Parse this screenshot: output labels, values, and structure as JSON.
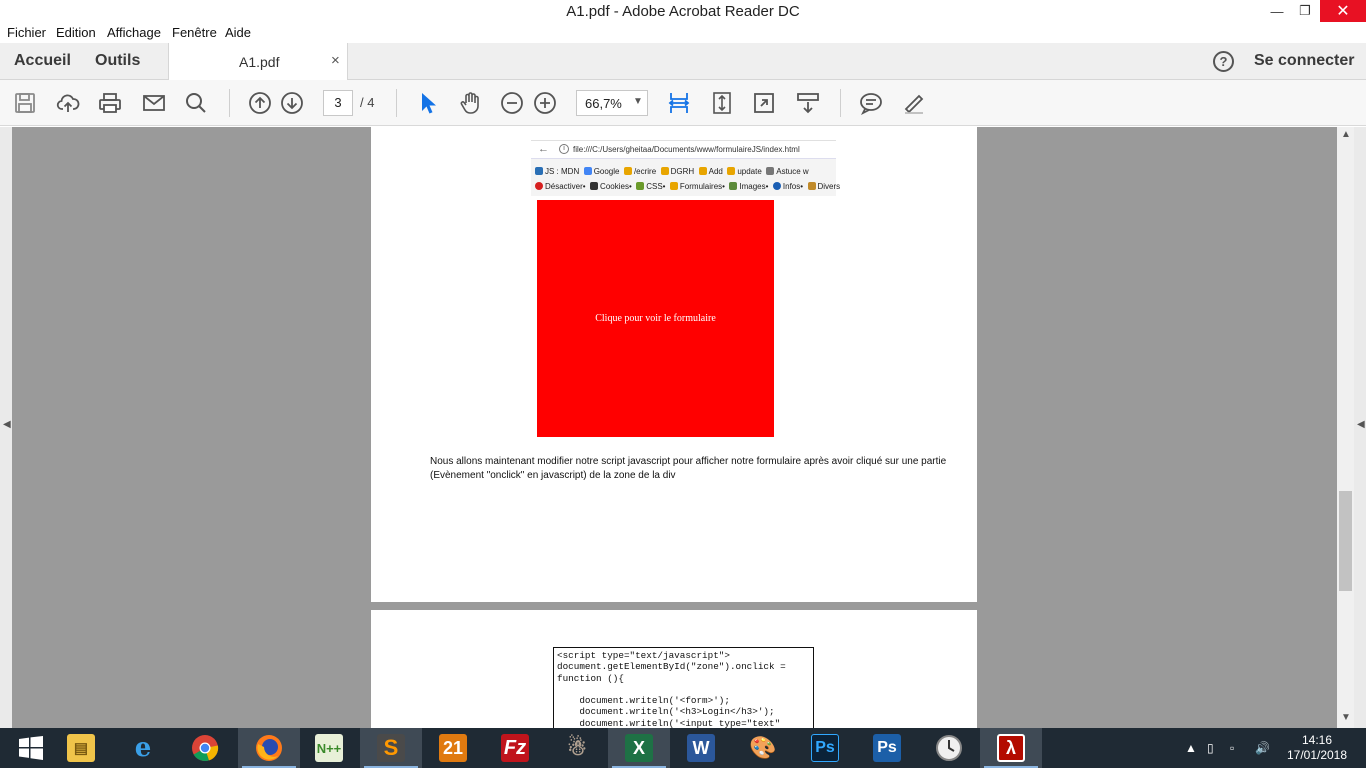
{
  "window": {
    "title": "A1.pdf - Adobe Acrobat Reader DC",
    "minimize_glyph": "—",
    "maximize_glyph": "❐",
    "close_glyph": "✕"
  },
  "menu": [
    "Fichier",
    "Edition",
    "Affichage",
    "Fenêtre",
    "Aide"
  ],
  "tabs": {
    "home": "Accueil",
    "tools": "Outils",
    "document": "A1.pdf",
    "close_glyph": "×",
    "help_glyph": "?",
    "sign_in": "Se connecter"
  },
  "toolbar": {
    "page_current": "3",
    "page_total": "/ 4",
    "zoom": "66,7%",
    "zoom_arrow": "▼",
    "accent": "#1473e6"
  },
  "page1": {
    "browser_url": "file:///C:/Users/gheitaa/Documents/www/formulaireJS/index.html",
    "bookmarks_row1": [
      "JS : MDN",
      "Google",
      "/ecrire",
      "DGRH",
      "Add",
      "update",
      "Astuce w"
    ],
    "bookmarks_row2": [
      "Désactiver•",
      "Cookies•",
      "CSS•",
      "Formulaires•",
      "Images•",
      "Infos•",
      "Divers"
    ],
    "red_zone_text": "Clique pour voir le formulaire",
    "red_zone_color": "#ff0000",
    "paragraph": "Nous allons maintenant modifier notre script javascript pour afficher notre formulaire après avoir cliqué sur une partie (Evènement \"onclick\" en javascript) de la zone de la div"
  },
  "page2": {
    "code": "<script type=\"text/javascript\">\ndocument.getElementById(\"zone\").onclick =\nfunction (){\n\n    document.writeln('<form>');\n    document.writeln('<h3>Login</h3>');\n    document.writeln('<input type=\"text\""
  },
  "taskbar": {
    "apps": [
      "start",
      "file-explorer",
      "internet-explorer",
      "chrome",
      "firefox",
      "notepad-plus",
      "sublime-text",
      "filezilla-21",
      "filezilla",
      "gimp",
      "excel",
      "word",
      "paint",
      "photoshop",
      "photoshop-2",
      "clock-app",
      "acrobat-reader"
    ],
    "clock_time": "14:16",
    "clock_date": "17/01/2018"
  }
}
